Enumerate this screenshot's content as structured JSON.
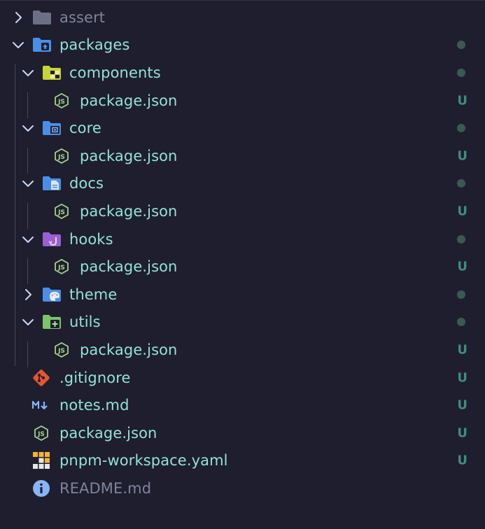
{
  "explorer": {
    "colors": {
      "background": "#1e1e2e",
      "text": "#94e2d5",
      "muted_text": "#7f849c",
      "untracked_status": "#3f8e7a",
      "modified_dot": "#3a5a50"
    },
    "items": [
      {
        "label": "assert",
        "icon": "folder-icon",
        "expanded": false,
        "status": ""
      },
      {
        "label": "packages",
        "icon": "folder-packages-icon",
        "expanded": true,
        "status": "dot"
      },
      {
        "label": "components",
        "icon": "folder-components-icon",
        "expanded": true,
        "status": "dot"
      },
      {
        "label": "package.json",
        "icon": "nodejs-icon",
        "status": "U"
      },
      {
        "label": "core",
        "icon": "folder-core-icon",
        "expanded": true,
        "status": "dot"
      },
      {
        "label": "package.json",
        "icon": "nodejs-icon",
        "status": "U"
      },
      {
        "label": "docs",
        "icon": "folder-docs-icon",
        "expanded": true,
        "status": "dot"
      },
      {
        "label": "package.json",
        "icon": "nodejs-icon",
        "status": "U"
      },
      {
        "label": "hooks",
        "icon": "folder-hooks-icon",
        "expanded": true,
        "status": "dot"
      },
      {
        "label": "package.json",
        "icon": "nodejs-icon",
        "status": "U"
      },
      {
        "label": "theme",
        "icon": "folder-theme-icon",
        "expanded": false,
        "status": "dot"
      },
      {
        "label": "utils",
        "icon": "folder-utils-icon",
        "expanded": true,
        "status": "dot"
      },
      {
        "label": "package.json",
        "icon": "nodejs-icon",
        "status": "U"
      },
      {
        "label": ".gitignore",
        "icon": "git-icon",
        "status": "U"
      },
      {
        "label": "notes.md",
        "icon": "markdown-icon",
        "status": "U"
      },
      {
        "label": "package.json",
        "icon": "nodejs-icon",
        "status": "U"
      },
      {
        "label": "pnpm-workspace.yaml",
        "icon": "pnpm-icon",
        "status": "U"
      },
      {
        "label": "README.md",
        "icon": "info-icon",
        "status": ""
      }
    ]
  }
}
